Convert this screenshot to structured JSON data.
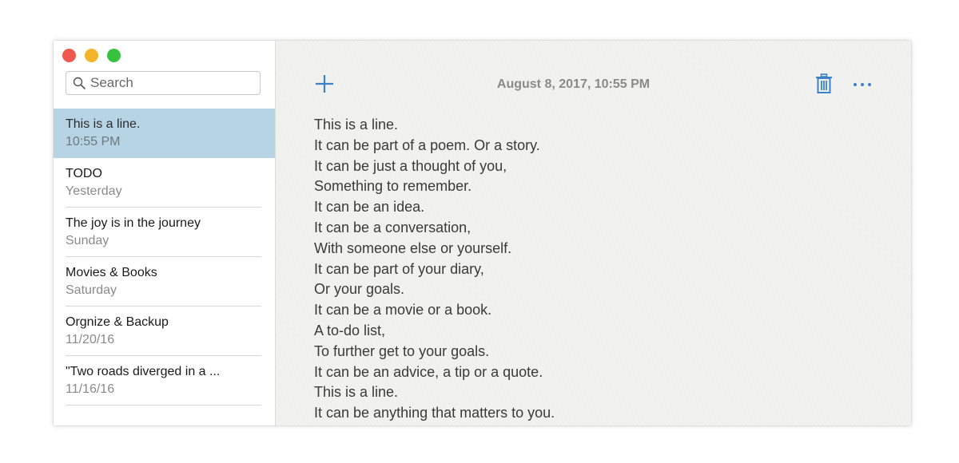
{
  "window": {
    "traffic_lights": [
      {
        "name": "close",
        "color": "#ee5850"
      },
      {
        "name": "minimize",
        "color": "#f5b52a"
      },
      {
        "name": "zoom",
        "color": "#36c13f"
      }
    ]
  },
  "sidebar": {
    "search": {
      "placeholder": "Search",
      "value": ""
    },
    "notes": [
      {
        "title": "This is a line.",
        "date": "10:55 PM",
        "selected": true
      },
      {
        "title": "TODO",
        "date": "Yesterday",
        "selected": false
      },
      {
        "title": "The joy is in the journey",
        "date": "Sunday",
        "selected": false
      },
      {
        "title": "Movies & Books",
        "date": "Saturday",
        "selected": false
      },
      {
        "title": "Orgnize & Backup",
        "date": "11/20/16",
        "selected": false
      },
      {
        "title": "\"Two roads diverged in a ...",
        "date": "11/16/16",
        "selected": false
      }
    ]
  },
  "main": {
    "toolbar": {
      "add_icon": "plus-icon",
      "timestamp": "August 8, 2017, 10:55 PM",
      "delete_icon": "trash-icon",
      "more_icon": "ellipsis-icon",
      "accent_color": "#3b82c8"
    },
    "body_lines": [
      "This is a line.",
      "It can be part of a poem. Or a story.",
      "It can be just a thought of you,",
      "Something to remember.",
      "It can be an idea.",
      "It can be a conversation,",
      "With someone else or yourself.",
      "It can be part of your diary,",
      "Or your goals.",
      "It can be a movie or a book.",
      "A to-do list,",
      "To further get to your goals.",
      "It can be an advice, a tip or a quote.",
      "This is a line.",
      "It can be anything that matters to you."
    ]
  }
}
